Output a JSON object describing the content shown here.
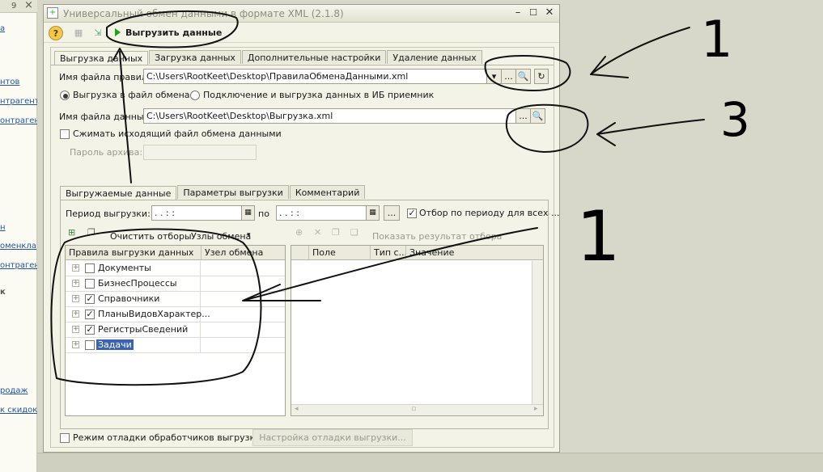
{
  "background_window": {
    "top_number": "9",
    "left_items": [
      "а",
      "нтов",
      "нтрагентов",
      "онтрагент",
      "н",
      "оменкла",
      "онтраген",
      "к",
      "родаж",
      "к скидок"
    ]
  },
  "dialog": {
    "title": "Универсальный обмен данными в формате XML (2.1.8)",
    "toolbar": {
      "help_icon": "?",
      "run_label": "Выгрузить данные"
    },
    "main_tabs": [
      "Выгрузка данных",
      "Загрузка данных",
      "Дополнительные настройки",
      "Удаление данных"
    ],
    "rules_file_label": "Имя файла правил:",
    "rules_file_value": "C:\\Users\\RootKeet\\Desktop\\ПравилаОбменаДанными.xml",
    "radio_file_label": "Выгрузка в файл обмена",
    "radio_ib_label": "Подключение и выгрузка данных в ИБ приемник",
    "data_file_label": "Имя файла данных:",
    "data_file_value": "C:\\Users\\RootKeet\\Desktop\\Выгрузка.xml",
    "compress_label": "Сжимать исходящий файл обмена данными",
    "archive_password_label": "Пароль архива:",
    "ellipsis": "...",
    "inner_tabs": [
      "Выгружаемые данные",
      "Параметры выгрузки",
      "Комментарий"
    ],
    "period_label": "Период выгрузки:",
    "period_start": "  .  .       :  :",
    "period_to": "по",
    "period_end": "  .  .       :  :",
    "period_filter_label": "Отбор по периоду для всех ...",
    "clear_filters_label": "Очистить отборы",
    "exchange_nodes_label": "Узлы обмена",
    "show_filter_label": "Показать результат отбора",
    "rules_table": {
      "headers": [
        "Правила выгрузки данных",
        "Узел обмена"
      ],
      "rows": [
        {
          "label": "Документы",
          "checked": false
        },
        {
          "label": "БизнесПроцессы",
          "checked": false
        },
        {
          "label": "Справочники",
          "checked": true
        },
        {
          "label": "ПланыВидовХарактер...",
          "checked": true
        },
        {
          "label": "РегистрыСведений",
          "checked": true
        },
        {
          "label": "Задачи",
          "checked": false
        }
      ]
    },
    "filter_table": {
      "headers": [
        "Поле",
        "Тип с...",
        "Значение"
      ]
    },
    "debug_label": "Режим отладки обработчиков выгрузки",
    "debug_settings_label": "Настройка отладки выгрузки..."
  },
  "annotations": {
    "number_1_top": "1",
    "number_3": "3",
    "number_1_mid": "1"
  }
}
